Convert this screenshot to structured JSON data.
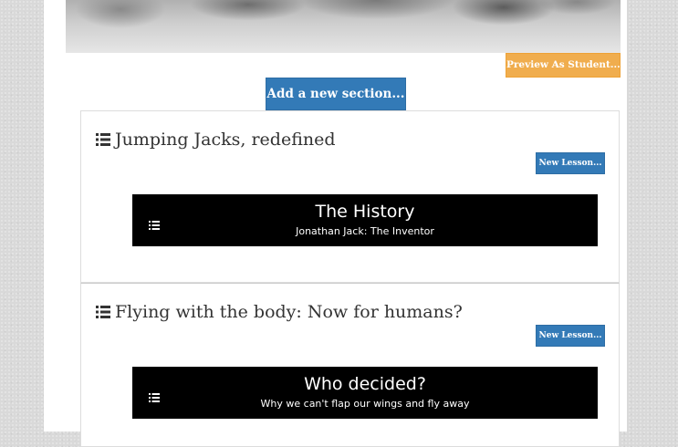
{
  "preview_button": {
    "label": "Preview As Student..."
  },
  "add_section_button": {
    "label": "Add a new section..."
  },
  "sections": [
    {
      "title": "Jumping Jacks, redefined",
      "new_lesson_label": "New Lesson...",
      "lessons": [
        {
          "title": "The History",
          "subtitle": "Jonathan Jack: The Inventor"
        }
      ]
    },
    {
      "title": "Flying with the body: Now for humans?",
      "new_lesson_label": "New Lesson...",
      "lessons": [
        {
          "title": "Who decided?",
          "subtitle": "Why we can't flap our wings and fly away"
        }
      ]
    }
  ],
  "colors": {
    "primary": "#337ab7",
    "warning": "#f0ad4e",
    "lesson_bg": "#000000",
    "text": "#333333"
  },
  "icons": {
    "section_icon": "list-icon",
    "lesson_icon": "list-icon"
  }
}
